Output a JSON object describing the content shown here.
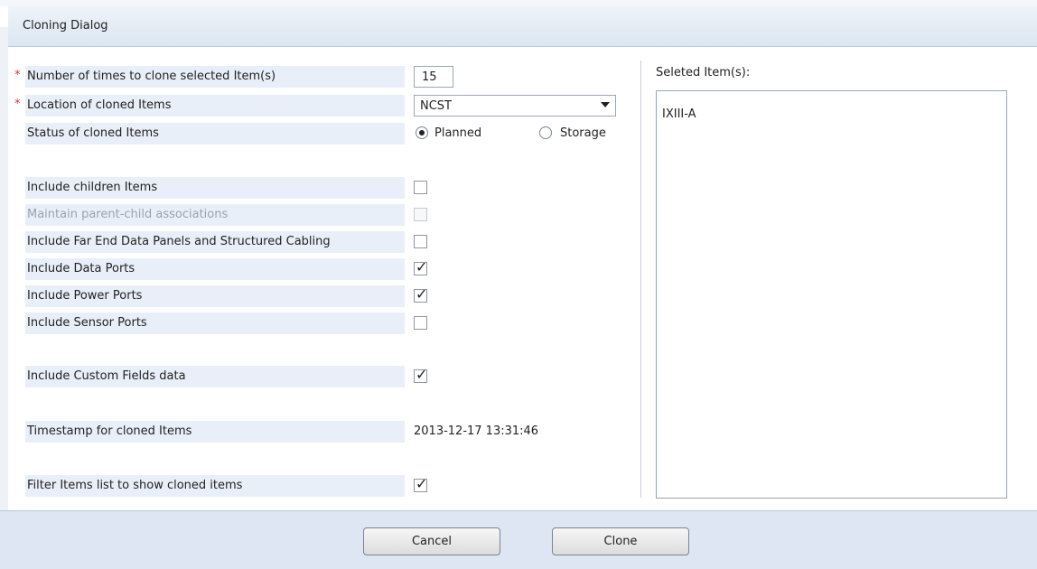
{
  "dialog": {
    "title": "Cloning Dialog"
  },
  "form": {
    "clone_count_label": "Number of times to clone selected Item(s)",
    "clone_count_value": "15",
    "location_label": "Location of cloned Items",
    "location_value": "NCST",
    "status_label": "Status of cloned Items",
    "status_options": {
      "planned": "Planned",
      "storage": "Storage"
    },
    "status_selected": "Planned",
    "required_mark": "*",
    "options": [
      {
        "label": "Include children Items",
        "checked": false,
        "disabled": false
      },
      {
        "label": "Maintain parent-child associations",
        "checked": false,
        "disabled": true
      },
      {
        "label": "Include Far End Data Panels and Structured Cabling",
        "checked": false,
        "disabled": false
      },
      {
        "label": "Include Data Ports",
        "checked": true,
        "disabled": false
      },
      {
        "label": "Include Power Ports",
        "checked": true,
        "disabled": false
      },
      {
        "label": "Include Sensor Ports",
        "checked": false,
        "disabled": false
      },
      {
        "label": "Include Custom Fields data",
        "checked": true,
        "disabled": false
      }
    ],
    "timestamp_label": "Timestamp for cloned Items",
    "timestamp_value": "2013-12-17 13:31:46",
    "filter_label": "Filter Items list to show cloned items",
    "filter_checked": true,
    "checkmark": "✓"
  },
  "selected": {
    "header": "Seleted Item(s):",
    "items": [
      "IXIII-A"
    ]
  },
  "buttons": {
    "cancel": "Cancel",
    "clone": "Clone"
  }
}
